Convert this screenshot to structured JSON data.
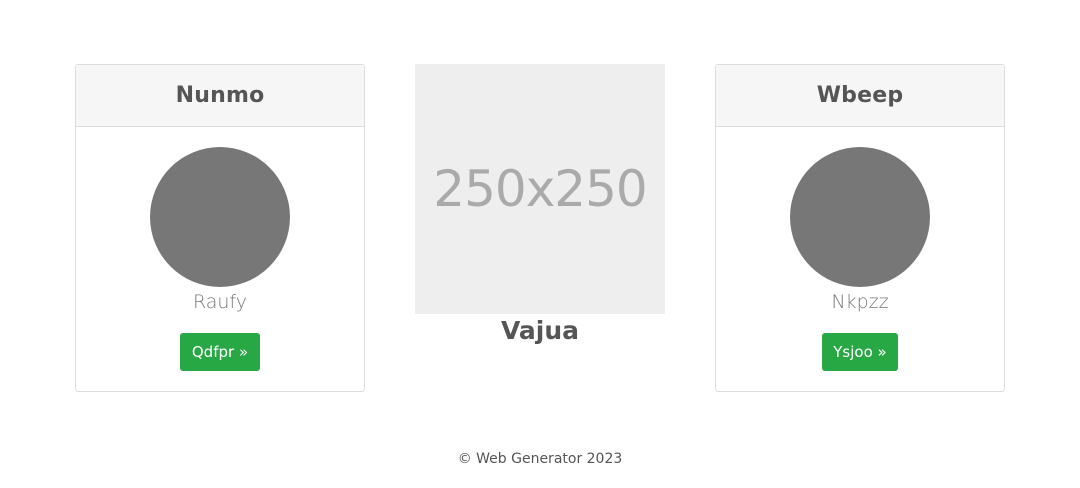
{
  "cards": [
    {
      "title": "Nunmo",
      "name": "Raufy",
      "button_label": "Qdfpr »"
    },
    {
      "title": "Wbeep",
      "name": "Nkpzz",
      "button_label": "Ysjoo »"
    }
  ],
  "center": {
    "placeholder_text": "250x250",
    "title": "Vajua"
  },
  "footer": {
    "text": "© Web Generator 2023"
  },
  "colors": {
    "button": "#28a745",
    "avatar": "#777777",
    "placeholder_bg": "#eeeeee"
  }
}
